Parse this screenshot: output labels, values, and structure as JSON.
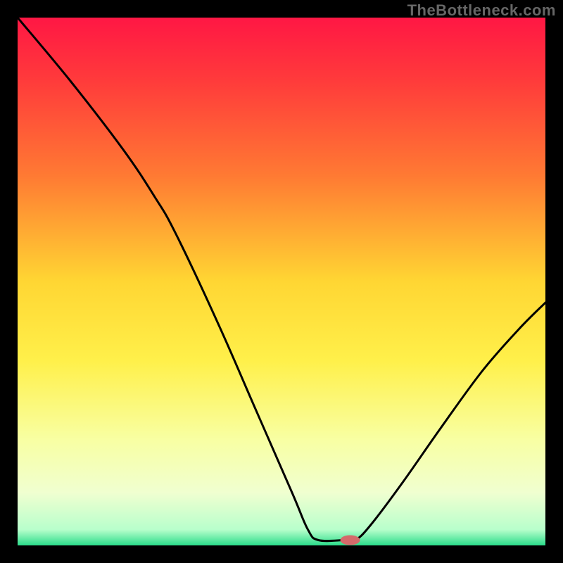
{
  "watermark": "TheBottleneck.com",
  "chart_data": {
    "type": "line",
    "title": "",
    "xlabel": "",
    "ylabel": "",
    "xlim": [
      0,
      100
    ],
    "ylim": [
      0,
      100
    ],
    "gradient_colors": [
      {
        "stop": 0.0,
        "color": "#ff1744"
      },
      {
        "stop": 0.12,
        "color": "#ff3b3b"
      },
      {
        "stop": 0.3,
        "color": "#ff7a33"
      },
      {
        "stop": 0.5,
        "color": "#ffd633"
      },
      {
        "stop": 0.65,
        "color": "#fff04a"
      },
      {
        "stop": 0.8,
        "color": "#f8ffa3"
      },
      {
        "stop": 0.9,
        "color": "#f0ffd0"
      },
      {
        "stop": 0.97,
        "color": "#b8ffcc"
      },
      {
        "stop": 1.0,
        "color": "#2bdc8a"
      }
    ],
    "curve": [
      {
        "x": 0,
        "y": 100
      },
      {
        "x": 10,
        "y": 88
      },
      {
        "x": 20,
        "y": 75
      },
      {
        "x": 26,
        "y": 66
      },
      {
        "x": 30,
        "y": 59
      },
      {
        "x": 38,
        "y": 42
      },
      {
        "x": 45,
        "y": 26
      },
      {
        "x": 52,
        "y": 10
      },
      {
        "x": 55,
        "y": 3
      },
      {
        "x": 57,
        "y": 1
      },
      {
        "x": 62,
        "y": 1
      },
      {
        "x": 64,
        "y": 1
      },
      {
        "x": 67,
        "y": 4
      },
      {
        "x": 73,
        "y": 12
      },
      {
        "x": 80,
        "y": 22
      },
      {
        "x": 88,
        "y": 33
      },
      {
        "x": 95,
        "y": 41
      },
      {
        "x": 100,
        "y": 46
      }
    ],
    "marker": {
      "x": 63,
      "y": 1,
      "color": "#d46a6a",
      "rx": 14,
      "ry": 7
    }
  }
}
